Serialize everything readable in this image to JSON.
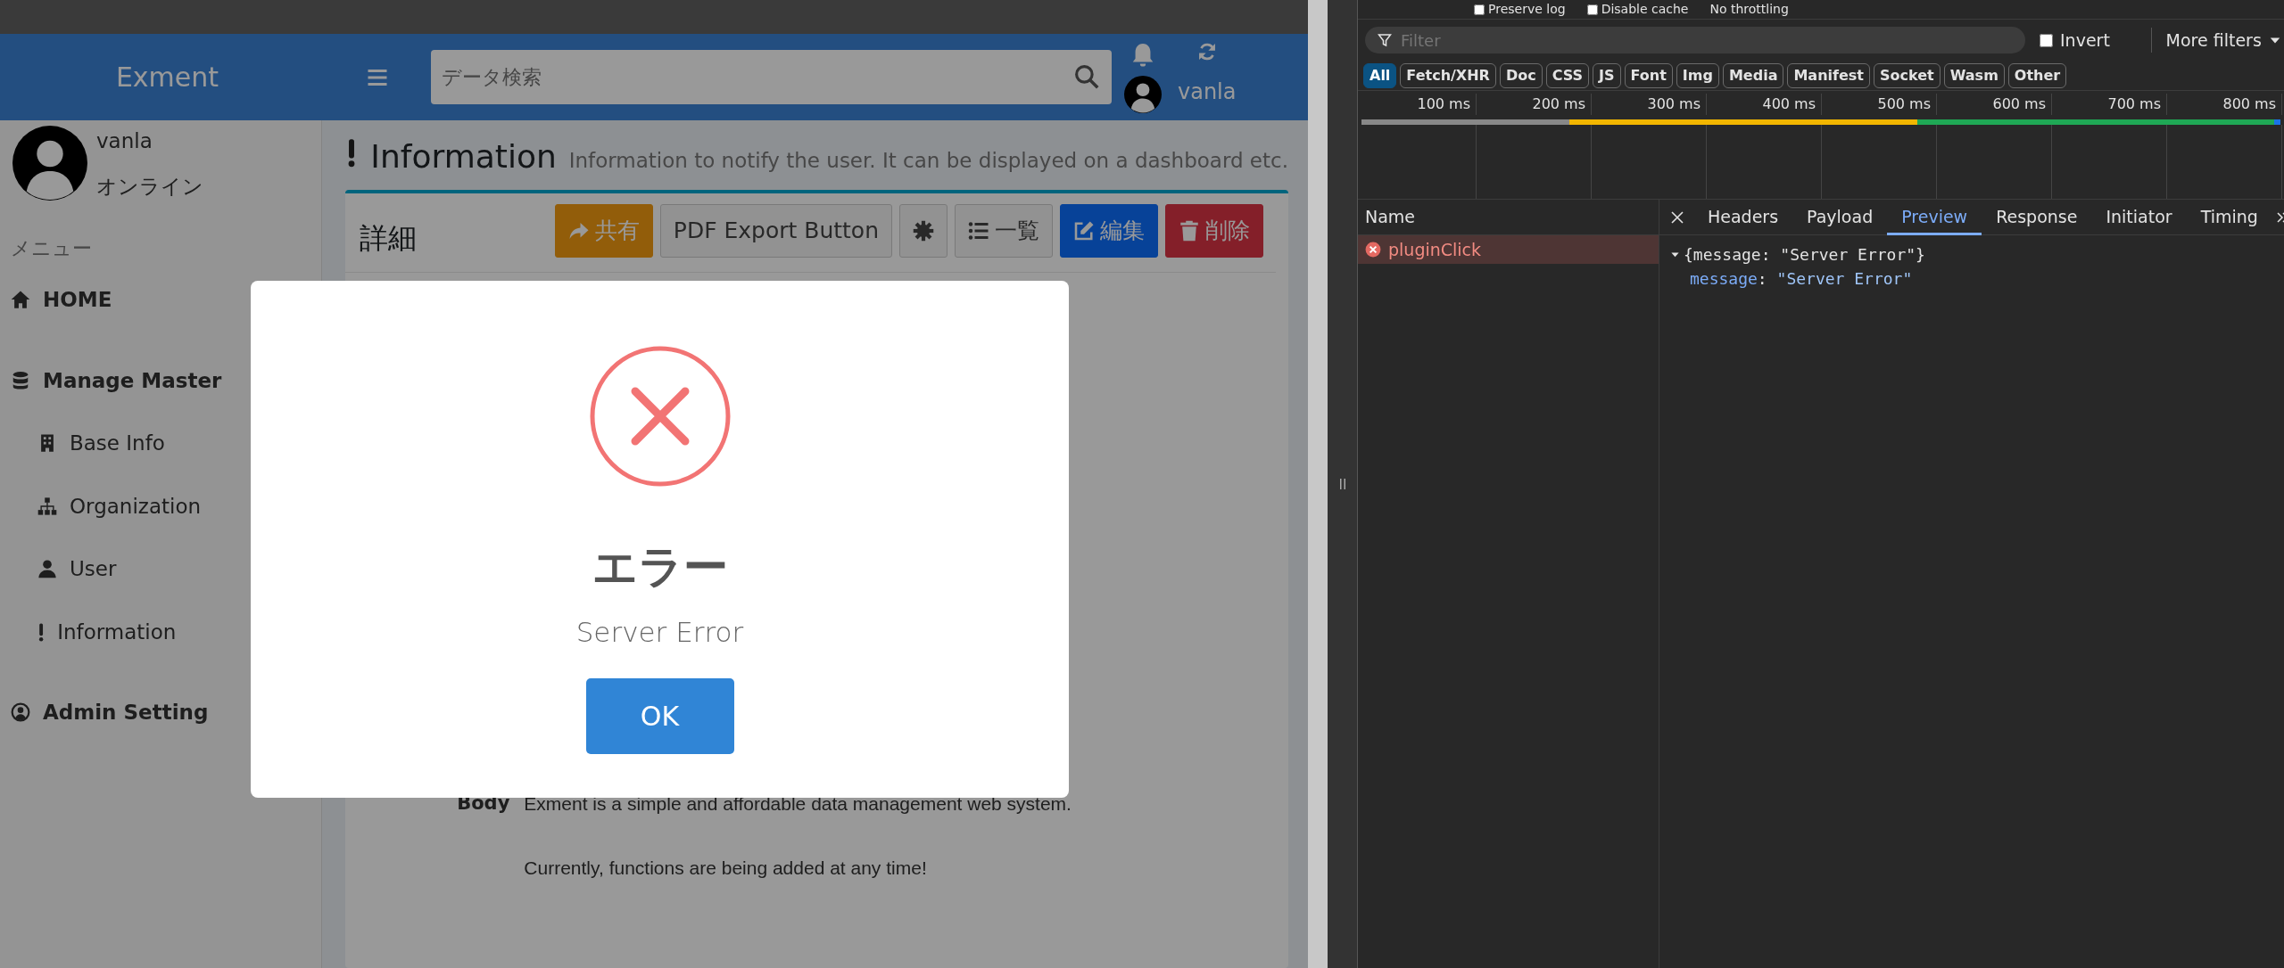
{
  "header": {
    "logo": "Exment",
    "search": {
      "placeholder": "データ検索"
    },
    "user": "vanla"
  },
  "sidebar": {
    "user": {
      "name": "vanla",
      "status": "オンライン"
    },
    "menu_label": "メニュー",
    "items": [
      {
        "label": "HOME"
      },
      {
        "label": "Manage Master",
        "children": [
          {
            "label": "Base Info"
          },
          {
            "label": "Organization"
          },
          {
            "label": "User"
          },
          {
            "label": "Information"
          }
        ]
      },
      {
        "label": "Admin Setting"
      }
    ]
  },
  "page": {
    "title": "Information",
    "subtitle": "Information to notify the user. It can be displayed on a dashboard etc."
  },
  "card": {
    "title": "詳細",
    "buttons": [
      {
        "kind": "share",
        "label": "共有"
      },
      {
        "kind": "pdf",
        "label": "PDF Export Button"
      },
      {
        "kind": "settings"
      },
      {
        "kind": "list",
        "label": "一覧"
      },
      {
        "kind": "edit",
        "label": "編集"
      },
      {
        "kind": "delete",
        "label": "削除"
      }
    ],
    "fields": [
      {
        "label": "Body",
        "paragraphs": [
          "Exment is a simple and affordable data management web system.",
          "Currently, functions are being added at any time!"
        ]
      }
    ]
  },
  "dialog": {
    "title": "エラー",
    "message": "Server Error",
    "buttons": [
      "OK"
    ]
  },
  "devtools": {
    "toolbar": [
      {
        "label": "Preserve log",
        "checked": false
      },
      {
        "label": "Disable cache",
        "checked": false
      },
      {
        "label": "No throttling"
      }
    ],
    "filter": {
      "placeholder": "Filter"
    },
    "invert": {
      "label": "Invert",
      "checked": false
    },
    "more_filters": "More filters",
    "types": [
      {
        "label": "All",
        "selected": true
      },
      {
        "label": "Fetch/XHR",
        "selected": false
      },
      {
        "label": "Doc",
        "selected": false
      },
      {
        "label": "CSS",
        "selected": false
      },
      {
        "label": "JS",
        "selected": false
      },
      {
        "label": "Font",
        "selected": false
      },
      {
        "label": "Img",
        "selected": false
      },
      {
        "label": "Media",
        "selected": false
      },
      {
        "label": "Manifest",
        "selected": false
      },
      {
        "label": "Socket",
        "selected": false
      },
      {
        "label": "Wasm",
        "selected": false
      },
      {
        "label": "Other",
        "selected": false
      }
    ],
    "timeline": {
      "ticks": [
        "100 ms",
        "200 ms",
        "300 ms",
        "400 ms",
        "500 ms",
        "600 ms",
        "700 ms",
        "800 ms"
      ]
    },
    "requests": {
      "column": "Name",
      "rows": [
        {
          "name": "pluginClick",
          "failed": true,
          "selected": true
        }
      ]
    },
    "tabs": [
      {
        "label": "Headers",
        "selected": false
      },
      {
        "label": "Payload",
        "selected": false
      },
      {
        "label": "Preview",
        "selected": true
      },
      {
        "label": "Response",
        "selected": false
      },
      {
        "label": "Initiator",
        "selected": false
      },
      {
        "label": "Timing",
        "selected": false
      }
    ],
    "preview": {
      "summary": "{message: \"Server Error\"}",
      "expanded": true,
      "key": "message",
      "separator": ":",
      "value": "\"Server Error\""
    }
  }
}
